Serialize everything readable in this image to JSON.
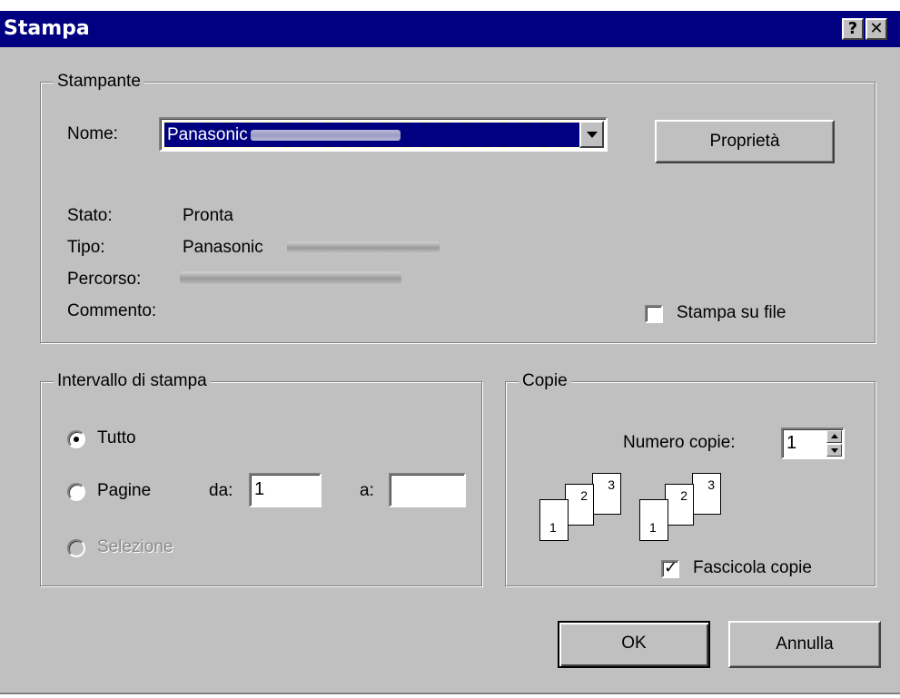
{
  "window": {
    "title": "Stampa",
    "help_label": "?",
    "close_label": "✕"
  },
  "printer_group": {
    "legend": "Stampante",
    "name_label": "Nome:",
    "name_value": "Panasonic",
    "properties_button": "Proprietà",
    "status_label": "Stato:",
    "status_value": "Pronta",
    "type_label": "Tipo:",
    "type_value": "Panasonic",
    "path_label": "Percorso:",
    "comment_label": "Commento:",
    "print_to_file_label": "Stampa su file",
    "print_to_file_checked": false
  },
  "range_group": {
    "legend": "Intervallo di stampa",
    "all_label": "Tutto",
    "pages_label": "Pagine",
    "from_label": "da:",
    "from_value": "1",
    "to_label": "a:",
    "to_value": "",
    "selection_label": "Selezione",
    "selected": "all"
  },
  "copies_group": {
    "legend": "Copie",
    "count_label": "Numero copie:",
    "count_value": "1",
    "collate_label": "Fascicola copie",
    "collate_checked": true,
    "page_numbers": [
      "1",
      "2",
      "3"
    ]
  },
  "buttons": {
    "ok": "OK",
    "cancel": "Annulla"
  }
}
